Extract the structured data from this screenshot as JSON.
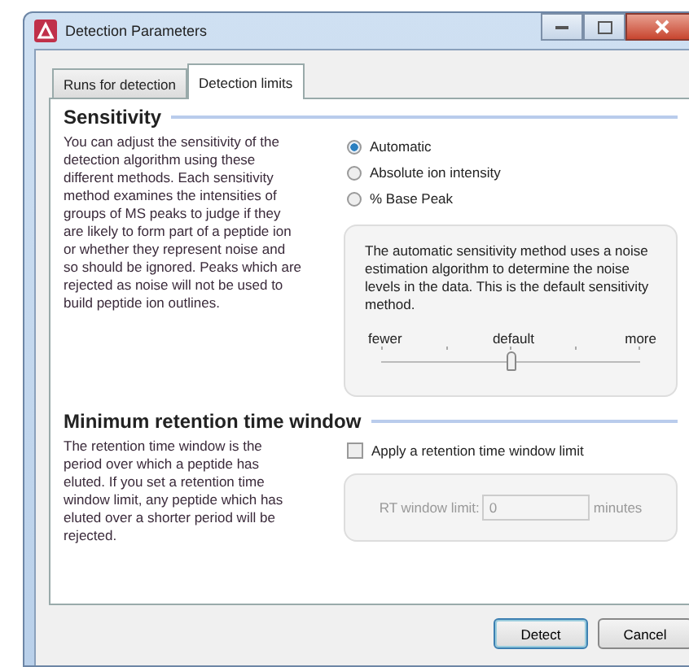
{
  "window": {
    "title": "Detection Parameters"
  },
  "tabs": [
    {
      "label": "Runs for detection",
      "selected": false
    },
    {
      "label": "Detection limits",
      "selected": true
    }
  ],
  "sensitivity": {
    "heading": "Sensitivity",
    "description": "You can adjust the sensitivity of the detection algorithm using these different methods. Each sensitivity method examines the intensities of groups of MS peaks to judge if they are likely to form part of a peptide ion or whether they represent noise and so should be ignored. Peaks which are rejected as noise will not be used to build peptide ion outlines.",
    "options": [
      {
        "label": "Automatic",
        "selected": true
      },
      {
        "label": "Absolute ion intensity",
        "selected": false
      },
      {
        "label": "% Base Peak",
        "selected": false
      }
    ],
    "info": "The automatic sensitivity method uses a noise estimation algorithm to determine the noise levels in the data. This is the default sensitivity method.",
    "slider": {
      "min_label": "fewer",
      "mid_label": "default",
      "max_label": "more",
      "level": 0.5
    }
  },
  "retention": {
    "heading": "Minimum retention time window",
    "description": "The retention time window is the period over which a peptide has eluted. If you set a retention time window limit, any peptide which has eluted over a shorter period will be rejected.",
    "checkbox": {
      "label": "Apply a retention time window limit",
      "checked": false
    },
    "field": {
      "label": "RT window limit:",
      "value": "0",
      "unit": "minutes",
      "disabled": true
    }
  },
  "buttons": [
    {
      "label": "Detect",
      "default": true
    },
    {
      "label": "Cancel",
      "default": false
    }
  ]
}
